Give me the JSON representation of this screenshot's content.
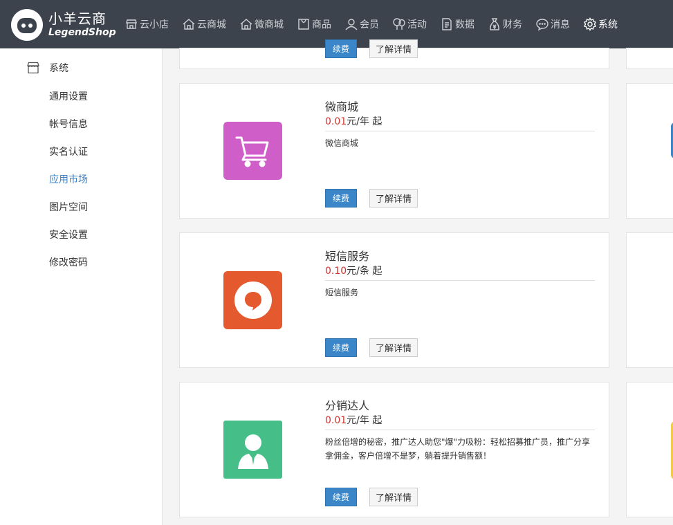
{
  "brand": {
    "name_cn": "小羊云商",
    "name_en": "LegendShop"
  },
  "nav": {
    "items": [
      {
        "label": "云小店",
        "icon": "store-icon"
      },
      {
        "label": "云商城",
        "icon": "home-icon"
      },
      {
        "label": "微商城",
        "icon": "home-outline-icon"
      },
      {
        "label": "商品",
        "icon": "bag-icon"
      },
      {
        "label": "会员",
        "icon": "user-icon"
      },
      {
        "label": "活动",
        "icon": "balloon-icon"
      },
      {
        "label": "数据",
        "icon": "document-icon"
      },
      {
        "label": "财务",
        "icon": "money-bag-icon"
      },
      {
        "label": "消息",
        "icon": "chat-icon"
      },
      {
        "label": "系统",
        "icon": "gear-icon"
      }
    ],
    "active": "系统"
  },
  "sidebar": {
    "header": "系统",
    "items": [
      "通用设置",
      "帐号信息",
      "实名认证",
      "应用市场",
      "图片空间",
      "安全设置",
      "修改密码"
    ],
    "active": "应用市场"
  },
  "partial_card": {
    "renew": "续费",
    "detail": "了解详情"
  },
  "apps": [
    {
      "title": "微商城",
      "price": "0.01",
      "unit": "元/年 起",
      "desc": "微信商城",
      "renew": "续费",
      "detail": "了解详情",
      "icon": "shopping-cart-icon",
      "color": "#d05ec9"
    },
    {
      "title": "短信服务",
      "price": "0.10",
      "unit": "元/条 起",
      "desc": "短信服务",
      "renew": "续费",
      "detail": "了解详情",
      "icon": "chat-bubble-icon",
      "color": "#e45a2e"
    },
    {
      "title": "分销达人",
      "price": "0.01",
      "unit": "元/年 起",
      "desc": "粉丝倍增的秘密，推广达人助您\"爆\"力吸粉：轻松招募推广员，推广分享拿佣金，客户倍增不是梦，躺着提升销售额！",
      "renew": "续费",
      "detail": "了解详情",
      "icon": "person-icon",
      "color": "#45bf87"
    }
  ],
  "colors": {
    "topbar": "#3c434c",
    "accent": "#3a86c8",
    "price": "#d2322d",
    "active_link": "#3f80c4"
  }
}
